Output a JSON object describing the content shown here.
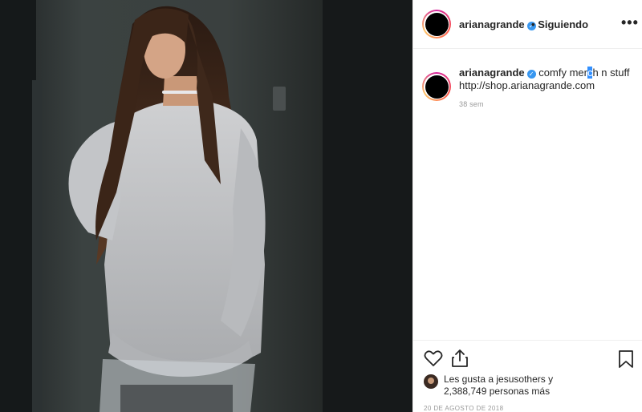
{
  "post": {
    "username": "arianagrande",
    "follow_separator": "•",
    "follow_status": "Siguiendo",
    "more_glyph": "•••"
  },
  "caption": {
    "username": "arianagrande",
    "text_before": "comfy mer",
    "text_selected": "c",
    "text_after": "h n stuff",
    "link": "http://shop.arianagrande.com",
    "time": "38 sem"
  },
  "likes": {
    "line1": "Les gusta a jesusothers y",
    "line2": "2,388,749 personas más"
  },
  "date": "20 DE AGOSTO DE 2018",
  "icons": {
    "like": "heart-icon",
    "share": "share-icon",
    "save": "bookmark-icon",
    "verified": "verified-badge-icon"
  },
  "colors": {
    "verified": "#3897f0",
    "selection": "#3390ff",
    "border": "#efefef",
    "muted": "#999999"
  }
}
